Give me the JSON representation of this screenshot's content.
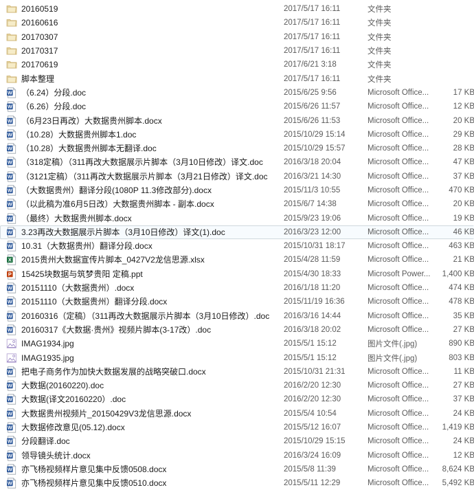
{
  "window": {
    "view": "details",
    "background_color": "#ffffff",
    "selection_fill": "#f7fbfe",
    "selection_border": "#cfd8de",
    "text_color": "#1b1b1b",
    "meta_text_color": "#5a5a5a"
  },
  "columns": {
    "name": "",
    "date_modified": "",
    "type": "",
    "size": ""
  },
  "types": {
    "folder": "文件夹",
    "word": "Microsoft Office...",
    "excel": "Microsoft Office...",
    "powerpoint": "Microsoft Power...",
    "image": "图片文件(.jpg)"
  },
  "icons": {
    "folder": "folder-icon",
    "word": "word-document-icon",
    "excel": "excel-spreadsheet-icon",
    "powerpoint": "powerpoint-presentation-icon",
    "image": "jpg-image-icon"
  },
  "rows": [
    {
      "name": "20160519",
      "date": "2017/5/17 16:11",
      "type": "文件夹",
      "size": "",
      "icon": "folder",
      "selected": false
    },
    {
      "name": "20160616",
      "date": "2017/5/17 16:11",
      "type": "文件夹",
      "size": "",
      "icon": "folder",
      "selected": false
    },
    {
      "name": "20170307",
      "date": "2017/5/17 16:11",
      "type": "文件夹",
      "size": "",
      "icon": "folder",
      "selected": false
    },
    {
      "name": "20170317",
      "date": "2017/5/17 16:11",
      "type": "文件夹",
      "size": "",
      "icon": "folder",
      "selected": false
    },
    {
      "name": "20170619",
      "date": "2017/6/21 3:18",
      "type": "文件夹",
      "size": "",
      "icon": "folder",
      "selected": false
    },
    {
      "name": "脚本整理",
      "date": "2017/5/17 16:11",
      "type": "文件夹",
      "size": "",
      "icon": "folder",
      "selected": false
    },
    {
      "name": "（6.24）分段.doc",
      "date": "2015/6/25 9:56",
      "type": "Microsoft Office...",
      "size": "17 KB",
      "icon": "word",
      "selected": false
    },
    {
      "name": "（6.26）分段.doc",
      "date": "2015/6/26 11:57",
      "type": "Microsoft Office...",
      "size": "12 KB",
      "icon": "word",
      "selected": false
    },
    {
      "name": "（6月23日再改）大数据贵州脚本.docx",
      "date": "2015/6/26 11:53",
      "type": "Microsoft Office...",
      "size": "20 KB",
      "icon": "word",
      "selected": false
    },
    {
      "name": "（10.28）大数据贵州脚本1.doc",
      "date": "2015/10/29 15:14",
      "type": "Microsoft Office...",
      "size": "29 KB",
      "icon": "word",
      "selected": false
    },
    {
      "name": "（10.28）大数据贵州脚本无翻译.doc",
      "date": "2015/10/29 15:57",
      "type": "Microsoft Office...",
      "size": "28 KB",
      "icon": "word",
      "selected": false
    },
    {
      "name": "（318定稿）（311再改大数据展示片脚本（3月10日修改）译文.doc",
      "date": "2016/3/18 20:04",
      "type": "Microsoft Office...",
      "size": "47 KB",
      "icon": "word",
      "selected": false
    },
    {
      "name": "（3121定稿）（311再改大数据展示片脚本（3月21日修改）译文.doc",
      "date": "2016/3/21 14:30",
      "type": "Microsoft Office...",
      "size": "37 KB",
      "icon": "word",
      "selected": false
    },
    {
      "name": "（大数据贵州）翻译分段(1080P  11.3修改部分).docx",
      "date": "2015/11/3 10:55",
      "type": "Microsoft Office...",
      "size": "470 KB",
      "icon": "word",
      "selected": false
    },
    {
      "name": "（以此稿为准6月5日改）大数据贵州脚本 - 副本.docx",
      "date": "2015/6/7 14:38",
      "type": "Microsoft Office...",
      "size": "20 KB",
      "icon": "word",
      "selected": false
    },
    {
      "name": "（最终）大数据贵州脚本.docx",
      "date": "2015/9/23 19:06",
      "type": "Microsoft Office...",
      "size": "19 KB",
      "icon": "word",
      "selected": false
    },
    {
      "name": "3.23再改大数据展示片脚本（3月10日修改）译文(1).doc",
      "date": "2016/3/23 12:00",
      "type": "Microsoft Office...",
      "size": "46 KB",
      "icon": "word",
      "selected": true
    },
    {
      "name": "10.31（大数据贵州）翻译分段.docx",
      "date": "2015/10/31 18:17",
      "type": "Microsoft Office...",
      "size": "463 KB",
      "icon": "word",
      "selected": false
    },
    {
      "name": "2015贵州大数据宣传片脚本_0427V2龙信思源.xlsx",
      "date": "2015/4/28 11:59",
      "type": "Microsoft Office...",
      "size": "21 KB",
      "icon": "excel",
      "selected": false
    },
    {
      "name": "15425块数据与筑梦贵阳 定稿.ppt",
      "date": "2015/4/30 18:33",
      "type": "Microsoft Power...",
      "size": "1,400 KB",
      "icon": "powerpoint",
      "selected": false
    },
    {
      "name": "20151110（大数据贵州）.docx",
      "date": "2016/1/18 11:20",
      "type": "Microsoft Office...",
      "size": "474 KB",
      "icon": "word",
      "selected": false
    },
    {
      "name": "20151110（大数据贵州）翻译分段.docx",
      "date": "2015/11/19 16:36",
      "type": "Microsoft Office...",
      "size": "478 KB",
      "icon": "word",
      "selected": false
    },
    {
      "name": "20160316（定稿）（311再改大数据展示片脚本（3月10日修改）.doc",
      "date": "2016/3/16 14:44",
      "type": "Microsoft Office...",
      "size": "35 KB",
      "icon": "word",
      "selected": false
    },
    {
      "name": "20160317《大数据·贵州》视频片脚本(3-17改）.doc",
      "date": "2016/3/18 20:02",
      "type": "Microsoft Office...",
      "size": "27 KB",
      "icon": "word",
      "selected": false
    },
    {
      "name": "IMAG1934.jpg",
      "date": "2015/5/1 15:12",
      "type": "图片文件(.jpg)",
      "size": "890 KB",
      "icon": "image",
      "selected": false
    },
    {
      "name": "IMAG1935.jpg",
      "date": "2015/5/1 15:12",
      "type": "图片文件(.jpg)",
      "size": "803 KB",
      "icon": "image",
      "selected": false
    },
    {
      "name": "把电子商务作为加快大数据发展的战略突破口.docx",
      "date": "2015/10/31 21:31",
      "type": "Microsoft Office...",
      "size": "11 KB",
      "icon": "word",
      "selected": false
    },
    {
      "name": "大数据(20160220).doc",
      "date": "2016/2/20 12:30",
      "type": "Microsoft Office...",
      "size": "27 KB",
      "icon": "word",
      "selected": false
    },
    {
      "name": "大数据(译文20160220）.doc",
      "date": "2016/2/20 12:30",
      "type": "Microsoft Office...",
      "size": "37 KB",
      "icon": "word",
      "selected": false
    },
    {
      "name": "大数据贵州视频片_20150429V3龙信思源.docx",
      "date": "2015/5/4 10:54",
      "type": "Microsoft Office...",
      "size": "24 KB",
      "icon": "word",
      "selected": false
    },
    {
      "name": "大数据修改意见(05.12).docx",
      "date": "2015/5/12 16:07",
      "type": "Microsoft Office...",
      "size": "1,419 KB",
      "icon": "word",
      "selected": false
    },
    {
      "name": "分段翻译.doc",
      "date": "2015/10/29 15:15",
      "type": "Microsoft Office...",
      "size": "24 KB",
      "icon": "word",
      "selected": false
    },
    {
      "name": "领导镜头统计.docx",
      "date": "2016/3/24 16:09",
      "type": "Microsoft Office...",
      "size": "12 KB",
      "icon": "word",
      "selected": false
    },
    {
      "name": "亦飞杨视频样片意见集中反馈0508.docx",
      "date": "2015/5/8 11:39",
      "type": "Microsoft Office...",
      "size": "8,624 KB",
      "icon": "word",
      "selected": false
    },
    {
      "name": "亦飞杨视频样片意见集中反馈0510.docx",
      "date": "2015/5/11 12:29",
      "type": "Microsoft Office...",
      "size": "5,492 KB",
      "icon": "word",
      "selected": false
    }
  ]
}
